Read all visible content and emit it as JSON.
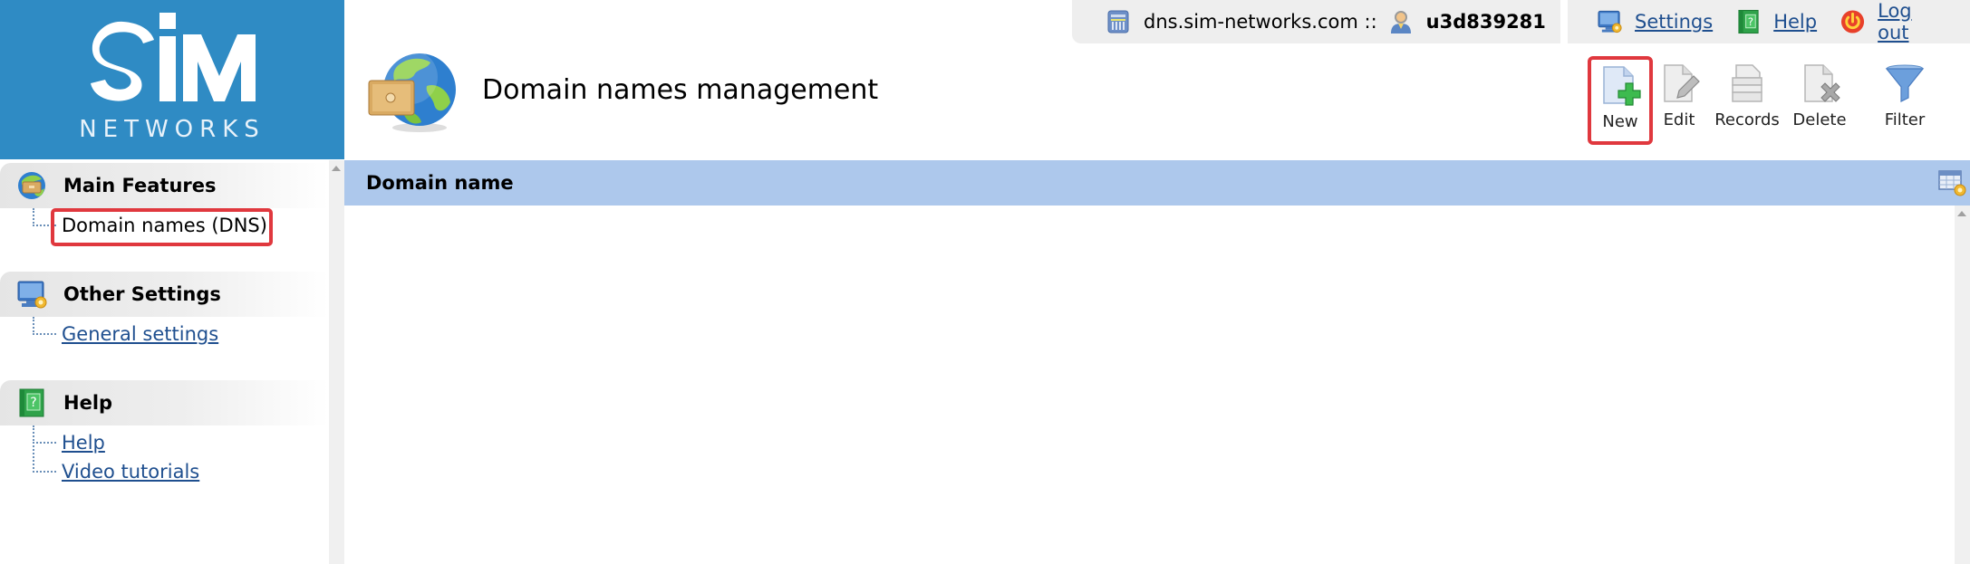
{
  "brand": {
    "logo_text": "SIM",
    "logo_subtext": "NETWORKS",
    "color": "#2f8bc4"
  },
  "topbar": {
    "server_icon": "server-icon",
    "server": "dns.sim-networks.com ::",
    "user_icon": "user-icon",
    "username": "u3d839281",
    "links": [
      {
        "icon": "monitor-settings-icon",
        "label": "Settings"
      },
      {
        "icon": "help-book-icon",
        "label": "Help"
      },
      {
        "icon": "power-icon",
        "label": "Log out"
      }
    ]
  },
  "page": {
    "title_icon": "globe-drawer-icon",
    "title": "Domain names management"
  },
  "toolbar": {
    "buttons": [
      {
        "id": "new",
        "icon": "new-document-icon",
        "label": "New",
        "highlighted": true
      },
      {
        "id": "edit",
        "icon": "edit-document-icon",
        "label": "Edit"
      },
      {
        "id": "records",
        "icon": "records-icon",
        "label": "Records"
      },
      {
        "id": "delete",
        "icon": "delete-document-icon",
        "label": "Delete"
      },
      {
        "id": "filter",
        "icon": "filter-funnel-icon",
        "label": "Filter"
      }
    ],
    "highlight_color": "#e0383e"
  },
  "sidebar": {
    "sections": [
      {
        "icon": "globe-drawer-icon",
        "title": "Main Features",
        "items": [
          {
            "label": "Domain names (DNS)",
            "active": true,
            "highlighted": true
          }
        ]
      },
      {
        "icon": "monitor-settings-icon",
        "title": "Other Settings",
        "items": [
          {
            "label": "General settings"
          }
        ]
      },
      {
        "icon": "help-book-icon",
        "title": "Help",
        "items": [
          {
            "label": "Help"
          },
          {
            "label": "Video tutorials"
          }
        ]
      }
    ]
  },
  "grid": {
    "columns": [
      "Domain name"
    ],
    "rows": [],
    "header_color": "#adc8ec",
    "settings_icon": "grid-settings-icon"
  }
}
